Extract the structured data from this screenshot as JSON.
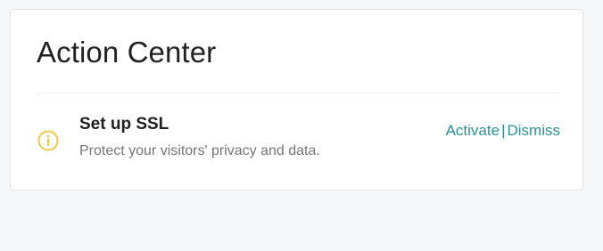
{
  "card": {
    "title": "Action Center"
  },
  "actions": [
    {
      "icon": "info-icon",
      "icon_color": "#f2c94c",
      "title": "Set up SSL",
      "description": "Protect your visitors' privacy and data.",
      "primary_link": "Activate",
      "separator": "|",
      "secondary_link": "Dismiss"
    }
  ],
  "colors": {
    "accent_link": "#2a8f97",
    "page_background": "#f5f7f8",
    "card_background": "#ffffff"
  }
}
